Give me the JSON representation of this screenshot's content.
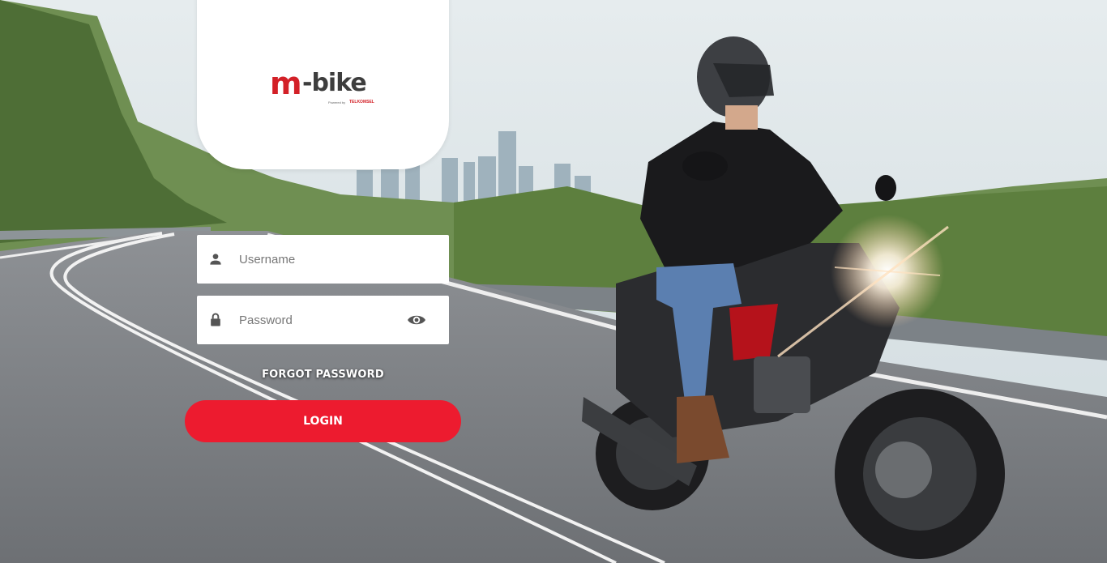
{
  "brand": {
    "logo_m": "m",
    "logo_bike": "-bike",
    "logo_powered": "Powered by",
    "logo_telkomsel": "TELKOMSEL",
    "accent_color": "#ed1b2f"
  },
  "login_form": {
    "username": {
      "placeholder": "Username",
      "value": "",
      "icon": "person-icon"
    },
    "password": {
      "placeholder": "Password",
      "value": "",
      "icon": "lock-icon",
      "toggle_icon": "eye-icon"
    },
    "forgot_password_label": "FORGOT PASSWORD",
    "login_label": "LOGIN"
  }
}
